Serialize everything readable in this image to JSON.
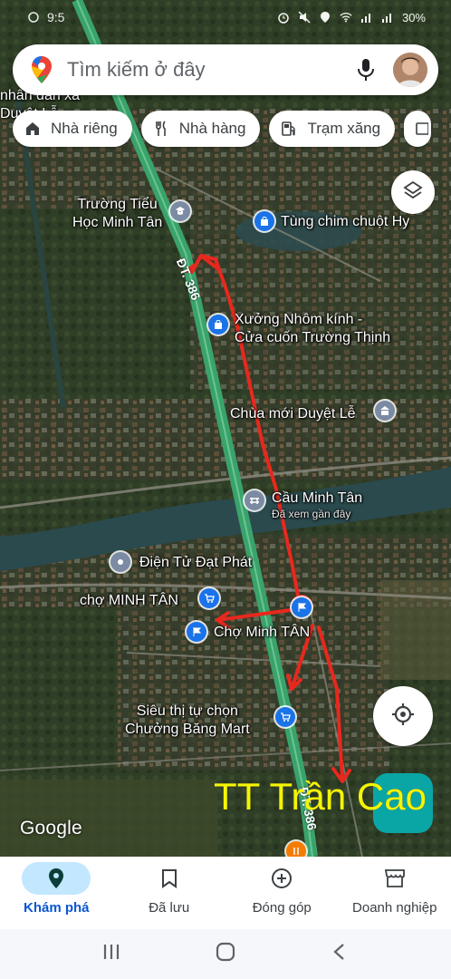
{
  "status_bar": {
    "time": "9:5",
    "battery": "30%"
  },
  "search": {
    "placeholder": "Tìm kiếm ở đây"
  },
  "chips": [
    {
      "label": "Nhà riêng",
      "icon": "home-icon"
    },
    {
      "label": "Nhà hàng",
      "icon": "restaurant-icon"
    },
    {
      "label": "Trạm xăng",
      "icon": "gas-station-icon"
    }
  ],
  "map": {
    "labels": {
      "partial_top": "nhân dân xã",
      "partial_top2": "Duyệt Lễ",
      "school": "Trường Tiểu\nHọc Minh Tân",
      "store_tung": "Tùng chim chuột Hy",
      "aluminum": "Xưởng Nhôm kính -\nCửa cuốn Trường Thịnh",
      "pagoda": "Chùa mới Duyệt Lễ",
      "bridge": "Cầu Minh Tân",
      "bridge_sub": "Đã xem gần đây",
      "electronics": "Điện Tử Đạt Phát",
      "market_upper": "chợ MINH TÂN",
      "market": "Chợ Minh TÂN",
      "supermarket": "Siêu thị tự chọn\nChưởng Băng Mart",
      "road_north": "ĐT. 386",
      "road_south": "ĐT. 386"
    },
    "annotation": "TT Trần Cao",
    "attribution": "Google",
    "colors": {
      "route": "#e8281e",
      "annotation": "#f5f500",
      "road": "#3aa36b",
      "water": "#2a4a4e"
    }
  },
  "bottom_nav": [
    {
      "label": "Khám phá",
      "icon": "explore-pin-icon",
      "active": true
    },
    {
      "label": "Đã lưu",
      "icon": "bookmark-icon",
      "active": false
    },
    {
      "label": "Đóng góp",
      "icon": "add-circle-icon",
      "active": false
    },
    {
      "label": "Doanh nghiệp",
      "icon": "storefront-icon",
      "active": false
    }
  ]
}
